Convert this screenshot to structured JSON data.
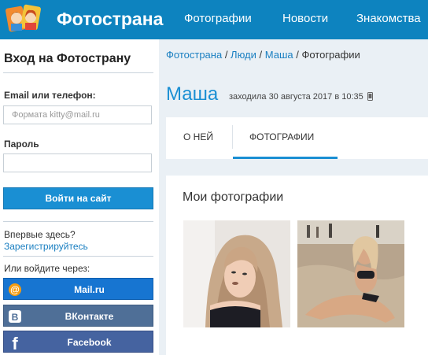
{
  "header": {
    "brand": "Фотострана",
    "nav": [
      "Фотографии",
      "Новости",
      "Знакомства"
    ]
  },
  "login": {
    "title": "Вход на Фотострану",
    "email_label": "Email или телефон:",
    "email_placeholder": "Формата kitty@mail.ru",
    "password_label": "Пароль",
    "submit_label": "Войти на сайт",
    "first_time": "Впервые здесь?",
    "register_link": "Зарегистрируйтесь",
    "login_via": "Или войдите через:",
    "social": [
      {
        "label": "Mail.ru",
        "icon": "at-icon"
      },
      {
        "label": "ВКонтакте",
        "icon": "vk-icon"
      },
      {
        "label": "Facebook",
        "icon": "facebook-icon"
      }
    ]
  },
  "breadcrumb": {
    "items": [
      "Фотострана",
      "Люди",
      "Маша"
    ],
    "separator": " / ",
    "current": "Фотографии"
  },
  "profile": {
    "name": "Маша",
    "last_seen": "заходила 30 августа 2017 в 10:35"
  },
  "tabs": [
    "О НЕЙ",
    "ФОТОГРАФИИ"
  ],
  "active_tab": "ФОТОГРАФИИ",
  "photos": {
    "title": "Мои фотографии",
    "count_shown": 2
  },
  "colors": {
    "header_bg": "#0d83bf",
    "accent": "#1a8fd3",
    "link": "#1a7fc1",
    "main_bg": "#eaf0f5"
  }
}
